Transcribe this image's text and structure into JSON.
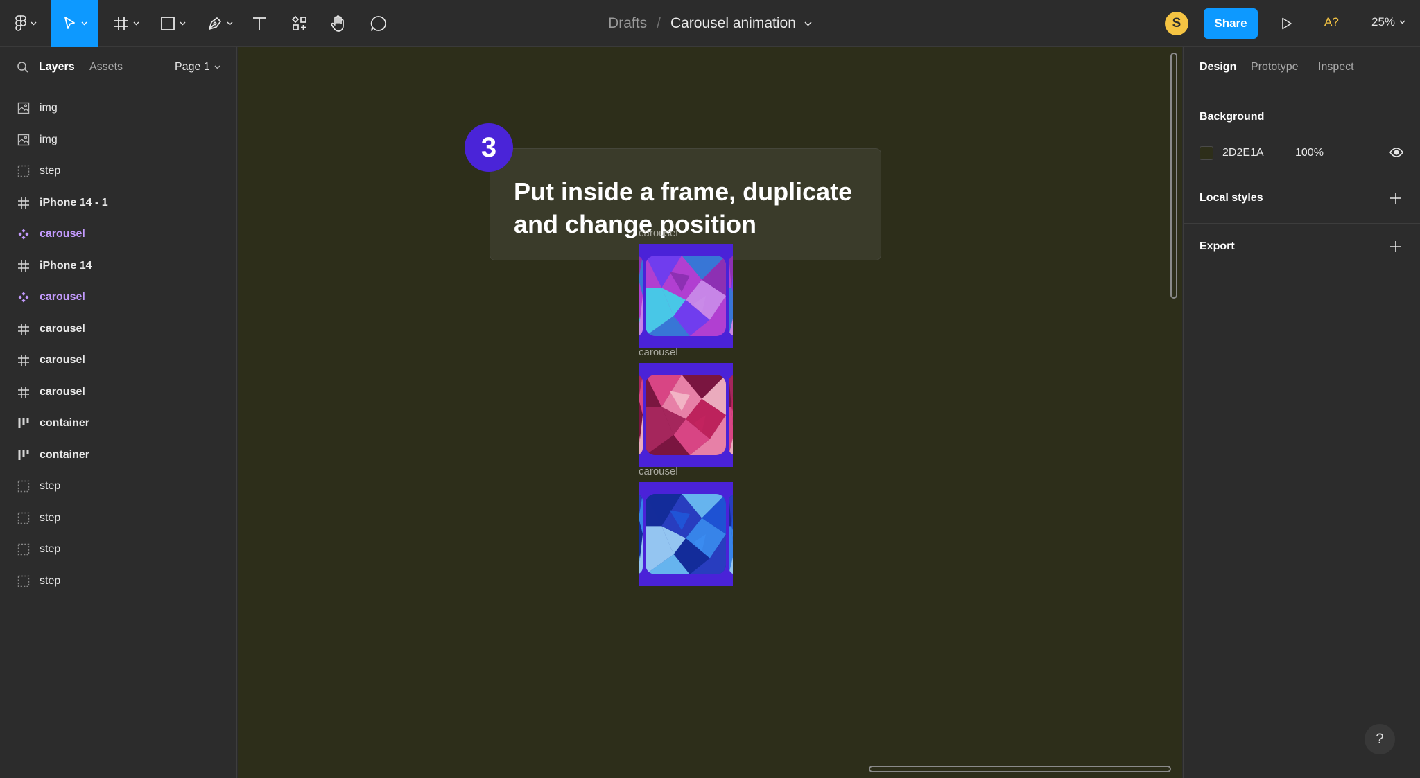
{
  "toolbar": {
    "breadcrumb_parent": "Drafts",
    "breadcrumb_separator": "/",
    "file_name": "Carousel animation",
    "user_initial": "S",
    "share_label": "Share",
    "accessibility_label": "A?",
    "zoom_label": "25%",
    "tools": [
      "main-menu",
      "move",
      "frame",
      "shape",
      "pen",
      "text",
      "resources",
      "hand",
      "comment"
    ]
  },
  "left_panel": {
    "tabs": {
      "layers": "Layers",
      "assets": "Assets"
    },
    "page_selector": "Page 1",
    "layers": [
      {
        "name": "img",
        "kind": "image"
      },
      {
        "name": "img",
        "kind": "image"
      },
      {
        "name": "step",
        "kind": "group"
      },
      {
        "name": "iPhone 14 - 1",
        "kind": "frame"
      },
      {
        "name": "carousel",
        "kind": "component"
      },
      {
        "name": "iPhone 14",
        "kind": "frame"
      },
      {
        "name": "carousel",
        "kind": "component"
      },
      {
        "name": "carousel",
        "kind": "frame"
      },
      {
        "name": "carousel",
        "kind": "frame"
      },
      {
        "name": "carousel",
        "kind": "frame"
      },
      {
        "name": "container",
        "kind": "autolayout"
      },
      {
        "name": "container",
        "kind": "autolayout"
      },
      {
        "name": "step",
        "kind": "group"
      },
      {
        "name": "step",
        "kind": "group"
      },
      {
        "name": "step",
        "kind": "group"
      },
      {
        "name": "step",
        "kind": "group"
      }
    ]
  },
  "canvas": {
    "background_color": "#2D2E1A",
    "step_number": "3",
    "step_text": "Put inside a frame, duplicate and change position",
    "frames": [
      {
        "label": "carousel",
        "theme": "purple"
      },
      {
        "label": "carousel",
        "theme": "pink"
      },
      {
        "label": "carousel",
        "theme": "blue"
      }
    ]
  },
  "right_panel": {
    "tabs": {
      "design": "Design",
      "prototype": "Prototype",
      "inspect": "Inspect"
    },
    "background_title": "Background",
    "background_hex": "2D2E1A",
    "background_opacity": "100%",
    "local_styles_title": "Local styles",
    "export_title": "Export"
  },
  "help_label": "?",
  "colors": {
    "accent": "#0d99ff",
    "component": "#c49bff",
    "step_badge": "#4a24d8",
    "carousel_frame": "#4a22d8",
    "avatar": "#f5c443"
  }
}
